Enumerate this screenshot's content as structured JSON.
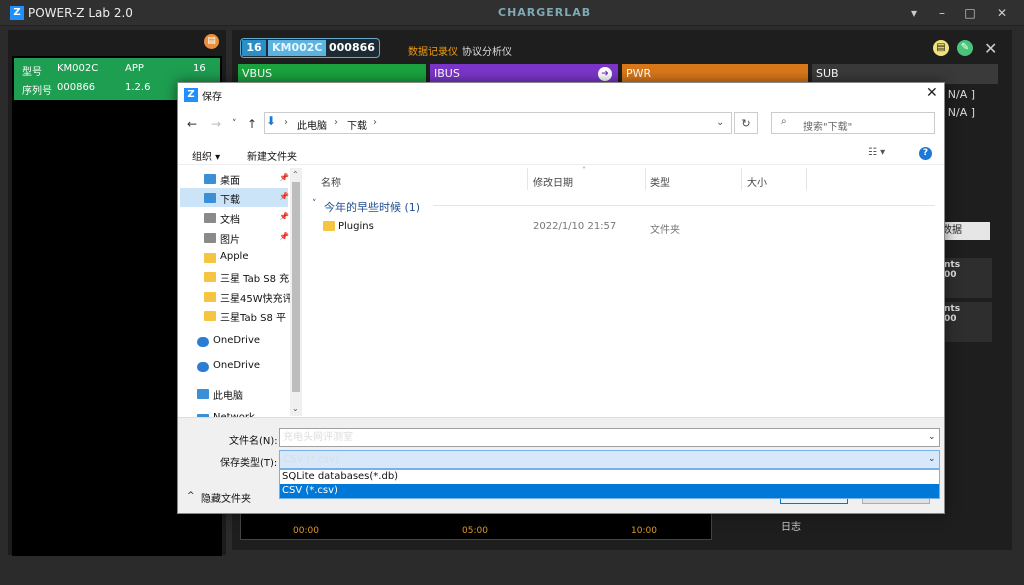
{
  "app": {
    "logo": "Z",
    "title": "POWER-Z Lab 2.0",
    "brand": "CHARGERLAB",
    "window_controls": [
      "▾",
      "–",
      "□",
      "✕"
    ]
  },
  "left_panel": {
    "device": {
      "model_label": "型号",
      "model_value": "KM002C",
      "app_label": "APP",
      "app_value": "16",
      "serial_label": "序列号",
      "serial_value": "000866",
      "version": "1.2.6"
    }
  },
  "main": {
    "pill": {
      "num": "16",
      "model": "KM002C",
      "serial": "000866"
    },
    "tabs": {
      "logger": "数据记录仪",
      "protocol": "协议分析仪"
    },
    "tiles": {
      "vbus": "VBUS",
      "ibus": "IBUS",
      "pwr": "PWR",
      "sub": "SUB"
    },
    "na_1": "[ N/A ]",
    "na_2": "[ N/A ]",
    "right_button_fragment": "数据",
    "right_box_1": [
      "nts",
      "00"
    ],
    "right_box_2": [
      "nts",
      "00"
    ],
    "chart_ticks": [
      "00:00",
      "05:00",
      "10:00"
    ],
    "log_label": "日志"
  },
  "dialog": {
    "logo": "Z",
    "title": "保存",
    "breadcrumbs": [
      "此电脑",
      "下载"
    ],
    "search_placeholder": "搜索\"下载\"",
    "toolbar": {
      "organize": "组织 ▾",
      "new_folder": "新建文件夹"
    },
    "nav_items": [
      {
        "label": "桌面",
        "pinned": true,
        "color": "#3a8fd6"
      },
      {
        "label": "下载",
        "pinned": true,
        "color": "#3a8fd6"
      },
      {
        "label": "文档",
        "pinned": true,
        "color": "#8a8a8a"
      },
      {
        "label": "图片",
        "pinned": true,
        "color": "#8a8a8a"
      },
      {
        "label": "Apple",
        "pinned": false,
        "color": "#f5c542"
      },
      {
        "label": "三星 Tab S8 充",
        "pinned": false,
        "color": "#f5c542"
      },
      {
        "label": "三星45W快充评",
        "pinned": false,
        "color": "#f5c542"
      },
      {
        "label": "三星Tab S8 平",
        "pinned": false,
        "color": "#f5c542"
      },
      {
        "label": "OneDrive",
        "pinned": false,
        "color": "#2b7cd3"
      },
      {
        "label": "OneDrive",
        "pinned": false,
        "color": "#2b7cd3"
      },
      {
        "label": "此电脑",
        "pinned": false,
        "color": "#3a8fd6"
      },
      {
        "label": "Network",
        "pinned": false,
        "color": "#3a8fd6"
      }
    ],
    "columns": [
      "名称",
      "修改日期",
      "类型",
      "大小"
    ],
    "group_header": "今年的早些时候 (1)",
    "rows": [
      {
        "name": "Plugins",
        "date": "2022/1/10 21:57",
        "type": "文件夹",
        "size": ""
      }
    ],
    "filename_label": "文件名(N):",
    "filename_value": "充电头网评测室",
    "filetype_label": "保存类型(T):",
    "filetype_value": "CSV (*.csv)",
    "filetype_options": [
      "SQLite databases(*.db)",
      "CSV (*.csv)"
    ],
    "hide_folders": "隐藏文件夹"
  }
}
